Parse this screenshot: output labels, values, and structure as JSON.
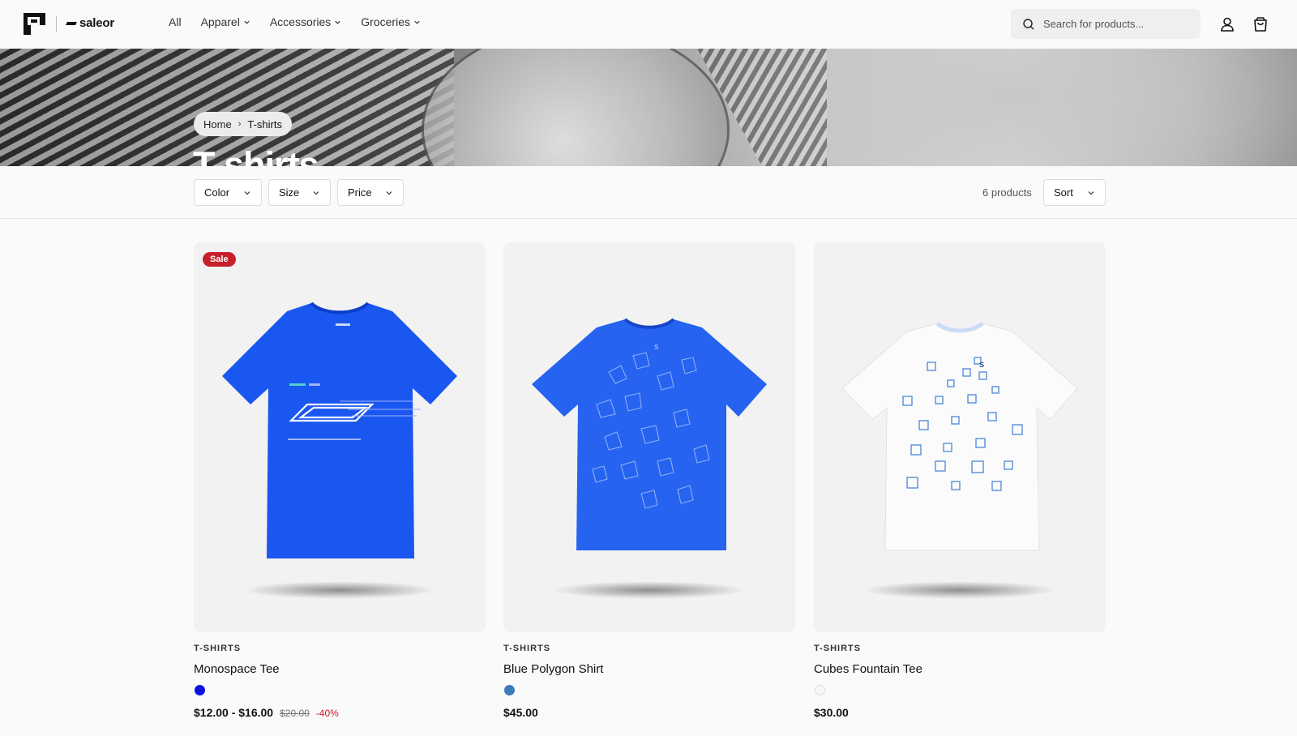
{
  "brand": {
    "logo_alt": "P",
    "partner": "saleor"
  },
  "nav": {
    "items": [
      {
        "label": "All",
        "has_dropdown": false
      },
      {
        "label": "Apparel",
        "has_dropdown": true
      },
      {
        "label": "Accessories",
        "has_dropdown": true
      },
      {
        "label": "Groceries",
        "has_dropdown": true
      }
    ]
  },
  "search": {
    "placeholder": "Search for products..."
  },
  "header_icons": [
    "search-icon",
    "user-icon",
    "cart-icon"
  ],
  "breadcrumb": {
    "home": "Home",
    "separator": "›",
    "current": "T-shirts"
  },
  "page": {
    "title": "T-shirts"
  },
  "filters": {
    "color": "Color",
    "size": "Size",
    "price": "Price"
  },
  "results": {
    "count": "6 products",
    "sort_label": "Sort"
  },
  "products": [
    {
      "badge": "Sale",
      "category": "T-SHIRTS",
      "name": "Monospace Tee",
      "swatch_color": "#0a10e0",
      "price": "$12.00 - $16.00",
      "old_price": "$20.00",
      "discount": "-40%",
      "shirt_color": "#1a56f0",
      "pattern": "monospace"
    },
    {
      "badge": "",
      "category": "T-SHIRTS",
      "name": "Blue Polygon Shirt",
      "swatch_color": "#3b7cb8",
      "price": "$45.00",
      "old_price": "",
      "discount": "",
      "shirt_color": "#2563f0",
      "pattern": "polygon"
    },
    {
      "badge": "",
      "category": "T-SHIRTS",
      "name": "Cubes Fountain Tee",
      "swatch_color": "#f6f6fb",
      "price": "$30.00",
      "old_price": "",
      "discount": "",
      "shirt_color": "#fbfbfb",
      "pattern": "cubes"
    }
  ],
  "colors": {
    "sale_red": "#c8202a",
    "banner_title": "#ffffff"
  }
}
